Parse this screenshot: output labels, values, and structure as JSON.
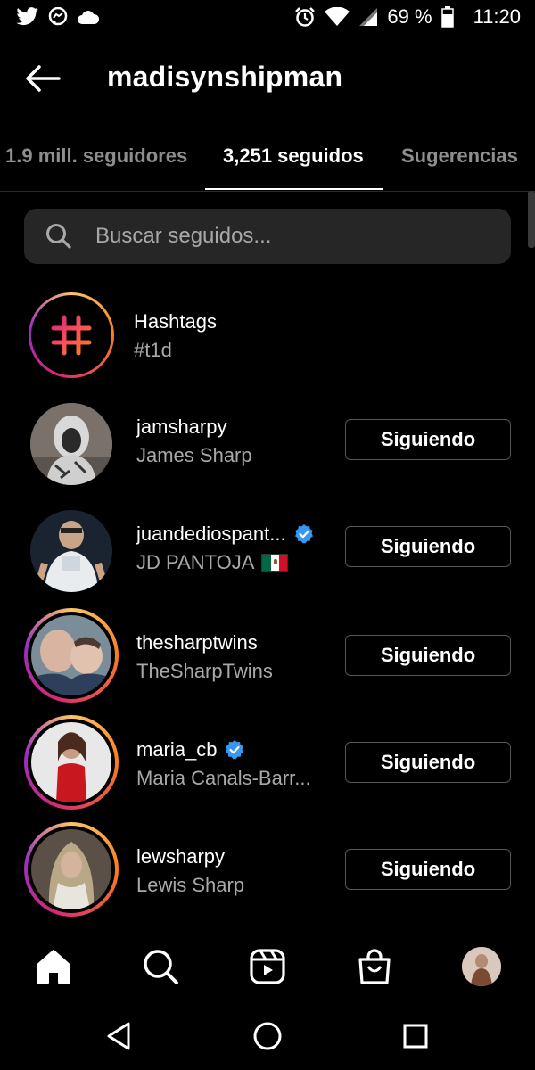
{
  "status_bar": {
    "battery": "69 %",
    "time": "11:20"
  },
  "header": {
    "title": "madisynshipman"
  },
  "tabs": [
    {
      "label": "1.9 mill. seguidores"
    },
    {
      "label": "3,251 seguidos"
    },
    {
      "label": "Sugerencias"
    }
  ],
  "search": {
    "placeholder": "Buscar seguidos..."
  },
  "hashtags": {
    "title": "Hashtags",
    "subtitle": "#t1d"
  },
  "following": [
    {
      "username": "jamsharpy",
      "name": "James Sharp",
      "button": "Siguiendo",
      "verified": false,
      "story_ring": false
    },
    {
      "username": "juandediospant...",
      "name": "JD PANTOJA",
      "button": "Siguiendo",
      "verified": true,
      "flag": "mexico-flag",
      "story_ring": false
    },
    {
      "username": "thesharptwins",
      "name": "TheSharpTwins",
      "button": "Siguiendo",
      "verified": false,
      "story_ring": true
    },
    {
      "username": "maria_cb",
      "name": "Maria Canals-Barr...",
      "button": "Siguiendo",
      "verified": true,
      "story_ring": true
    },
    {
      "username": "lewsharpy",
      "name": "Lewis Sharp",
      "button": "Siguiendo",
      "verified": false,
      "story_ring": true
    }
  ],
  "icons": {
    "status": [
      "twitter-icon",
      "messenger-icon",
      "cloud-icon",
      "alarm-icon",
      "wifi-icon",
      "signal-icon",
      "battery-icon"
    ],
    "nav": [
      "home-icon",
      "search-icon",
      "reels-icon",
      "shop-icon",
      "profile-avatar"
    ],
    "system": [
      "back-triangle-icon",
      "home-circle-icon",
      "recents-square-icon"
    ]
  },
  "colors": {
    "background": "#000000",
    "verified": "#3897f0",
    "muted_text": "#a8a8a8",
    "search_bg": "#262626"
  }
}
